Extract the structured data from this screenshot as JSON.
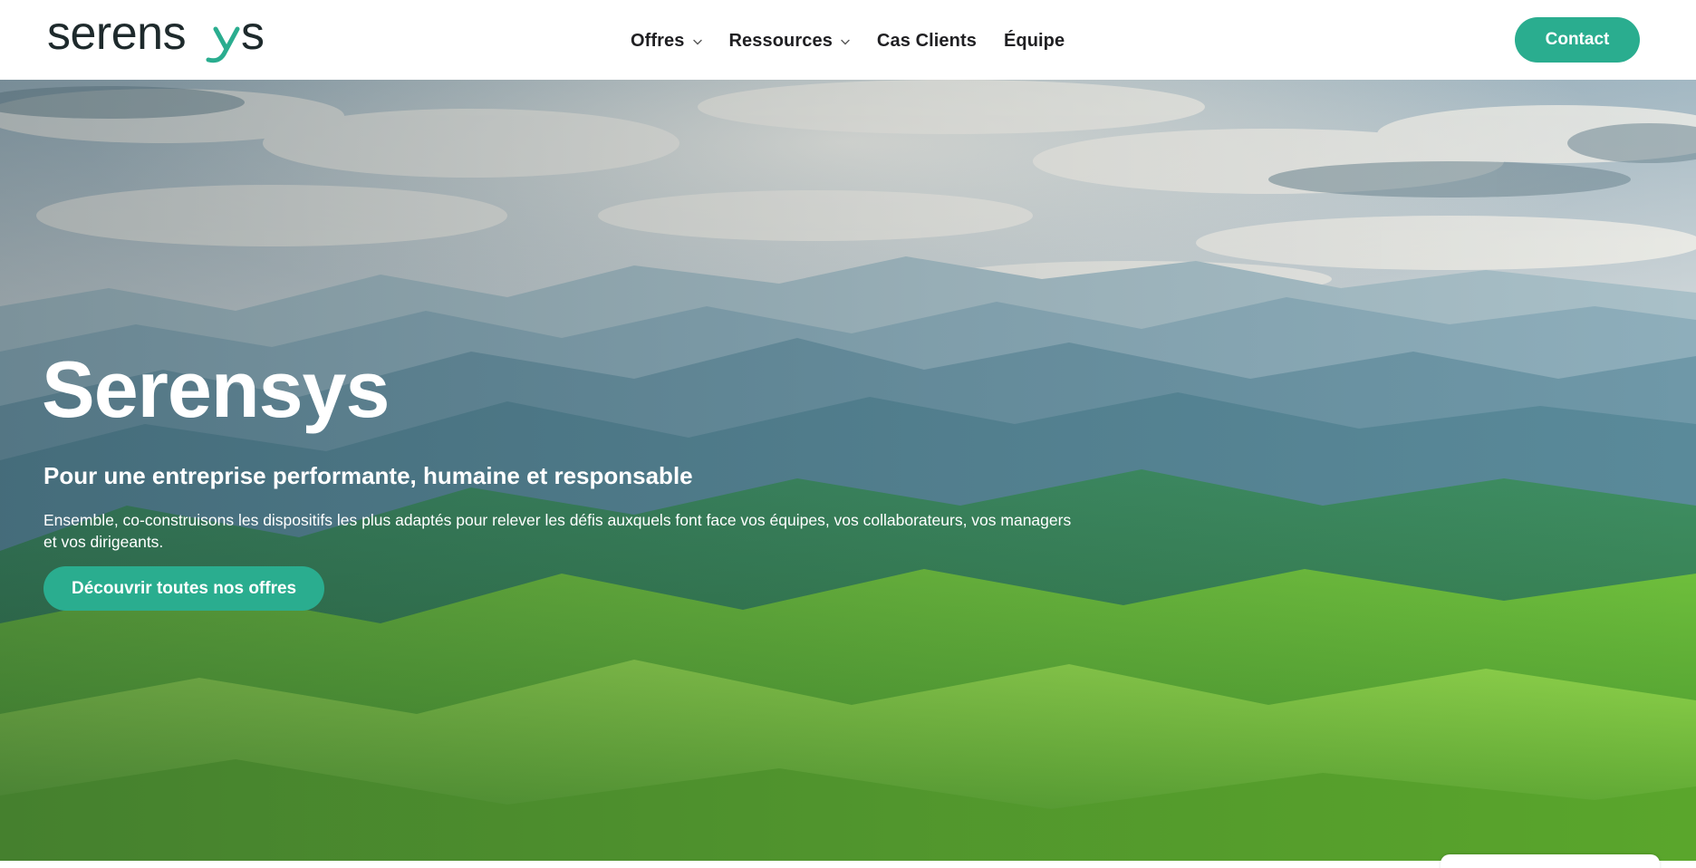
{
  "brand": {
    "logo_text": "serensys",
    "logo_color": "#1e2a2c",
    "accent_color": "#2aad8f"
  },
  "nav": {
    "items": [
      {
        "label": "Offres",
        "has_dropdown": true,
        "icon": "chevron-down-icon"
      },
      {
        "label": "Ressources",
        "has_dropdown": true,
        "icon": "chevron-down-icon"
      },
      {
        "label": "Cas Clients",
        "has_dropdown": false
      },
      {
        "label": "Équipe",
        "has_dropdown": false
      }
    ],
    "contact_label": "Contact"
  },
  "hero": {
    "title": "Serensys",
    "subtitle": "Pour une entreprise performante, humaine et responsable",
    "description": "Ensemble, co-construisons les dispositifs les plus adaptés pour relever les défis auxquels font face vos équipes, vos collaborateurs, vos managers et vos dirigeants.",
    "cta_label": "Découvrir toutes nos offres",
    "background": "mountain-landscape-image"
  }
}
